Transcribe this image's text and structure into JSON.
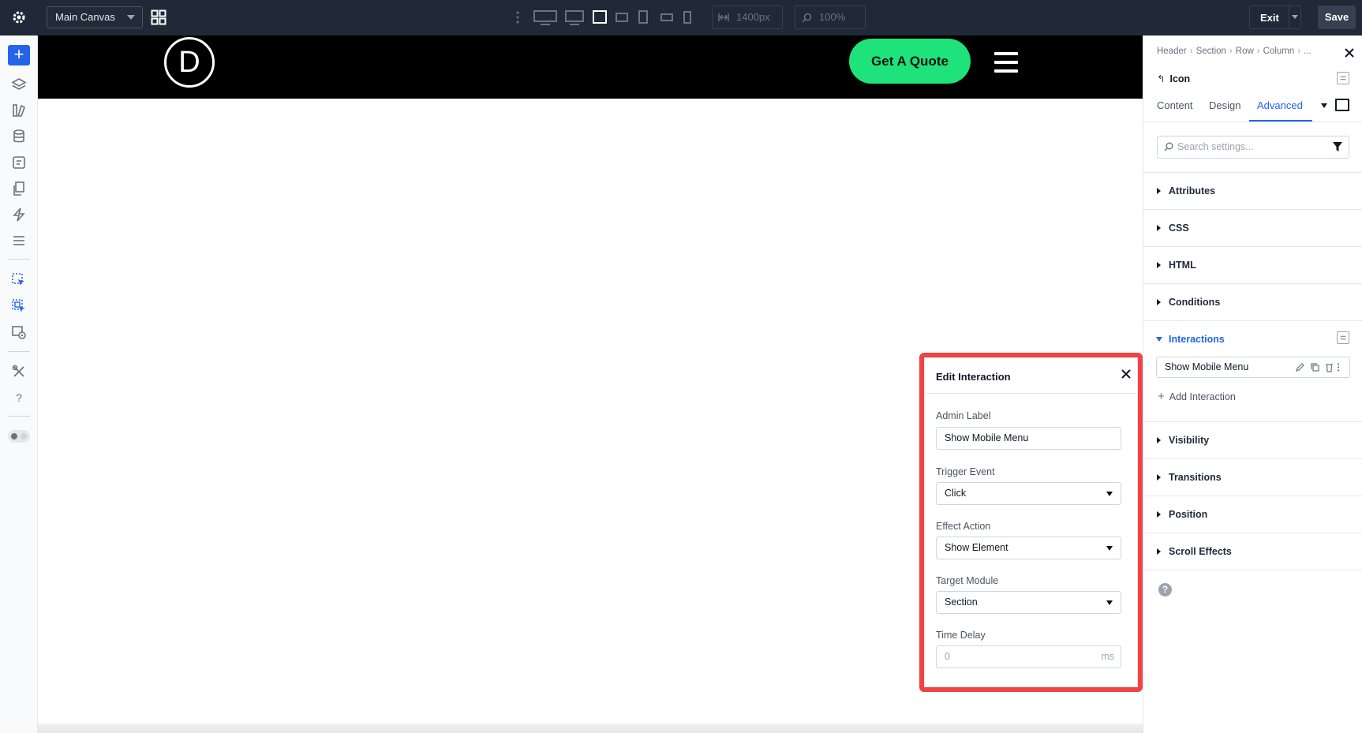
{
  "toolbar": {
    "canvas_select": "Main Canvas",
    "width_value": "1400px",
    "zoom_value": "100%",
    "exit_label": "Exit",
    "save_label": "Save"
  },
  "canvas": {
    "logo_letter": "D",
    "quote_button": "Get A Quote"
  },
  "popup": {
    "title": "Edit Interaction",
    "admin_label": {
      "label": "Admin Label",
      "value": "Show Mobile Menu"
    },
    "trigger_event": {
      "label": "Trigger Event",
      "value": "Click"
    },
    "effect_action": {
      "label": "Effect Action",
      "value": "Show Element"
    },
    "target_module": {
      "label": "Target Module",
      "value": "Section"
    },
    "time_delay": {
      "label": "Time Delay",
      "placeholder": "0",
      "unit": "ms"
    }
  },
  "panel": {
    "breadcrumb": [
      "Header",
      "Section",
      "Row",
      "Column",
      "..."
    ],
    "element_name": "Icon",
    "tabs": [
      "Content",
      "Design",
      "Advanced"
    ],
    "active_tab": "Advanced",
    "search_placeholder": "Search settings...",
    "sections_top": [
      "Attributes",
      "CSS",
      "HTML",
      "Conditions"
    ],
    "interactions_label": "Interactions",
    "interaction_item": "Show Mobile Menu",
    "add_interaction": "Add Interaction",
    "sections_bottom": [
      "Visibility",
      "Transitions",
      "Position",
      "Scroll Effects"
    ],
    "help_glyph": "?"
  },
  "colors": {
    "accent": "#2563eb",
    "highlight": "#ef4444",
    "quote_button": "#1ee37a",
    "toolbar_bg": "#1f2937"
  }
}
